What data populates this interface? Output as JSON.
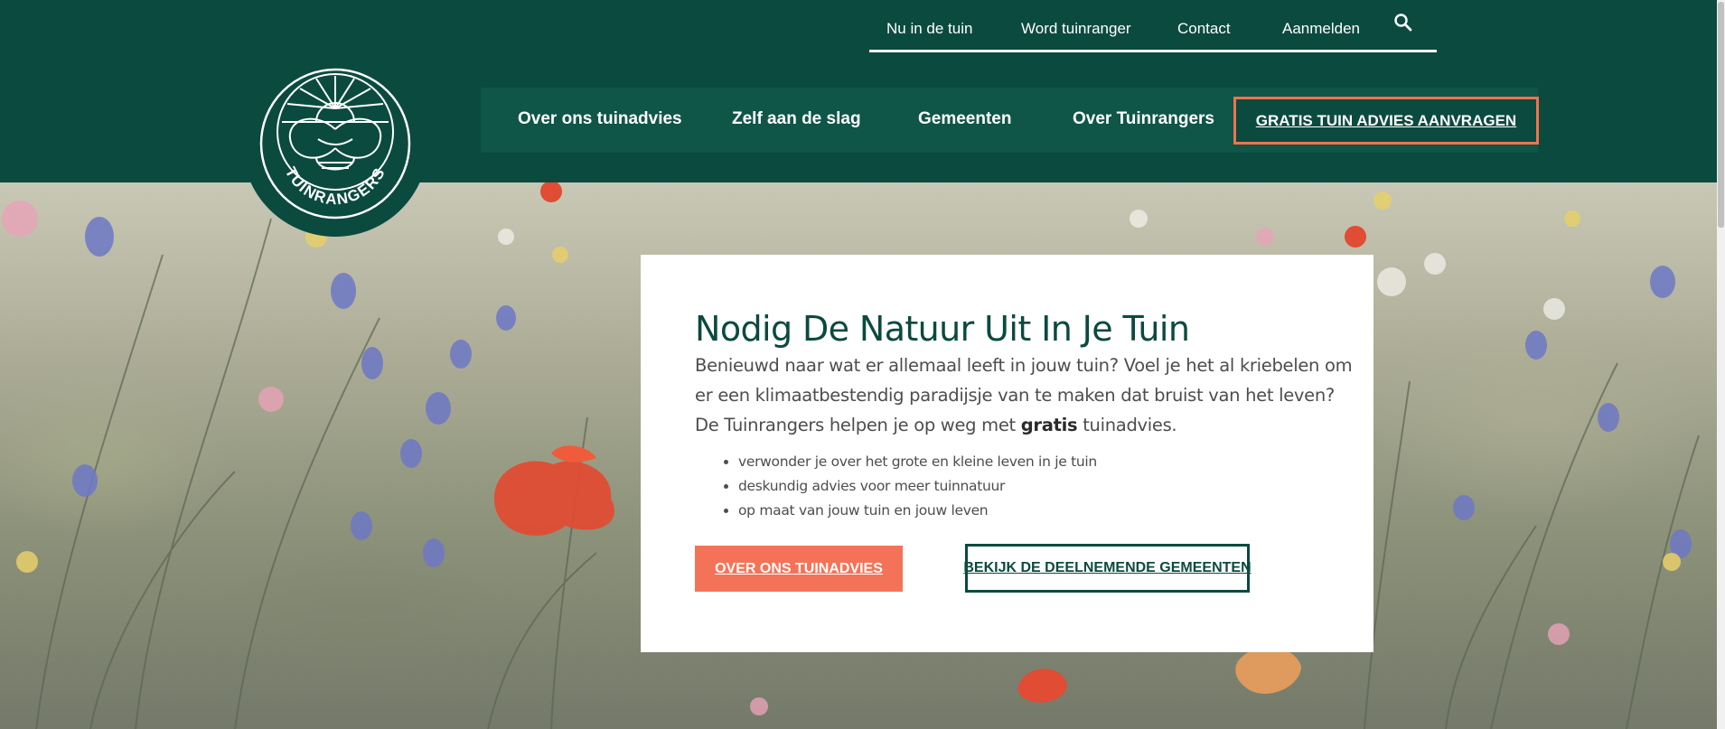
{
  "brand": {
    "name": "TUINRANGERS",
    "primary_color": "#0b4a3f",
    "accent_color": "#f47358"
  },
  "top_nav": {
    "items": [
      "Nu in de tuin",
      "Word tuinranger",
      "Contact",
      "Aanmelden"
    ],
    "search_icon": "search-icon"
  },
  "main_nav": {
    "items": [
      "Over ons tuinadvies",
      "Zelf aan de slag",
      "Gemeenten",
      "Over Tuinrangers"
    ],
    "cta": "GRATIS TUIN ADVIES AANVRAGEN"
  },
  "hero": {
    "title": "Nodig De Natuur Uit In Je Tuin",
    "intro_before": "Benieuwd naar wat er allemaal leeft in jouw tuin? Voel je het al kriebelen om er een klimaatbestendig paradijsje van te maken dat bruist van het leven? De Tuinrangers helpen je op weg met ",
    "intro_bold": "gratis",
    "intro_after": " tuinadvies.",
    "bullets": [
      "verwonder je over het grote en kleine leven in je tuin",
      "deskundig advies voor meer tuinnatuur",
      "op maat van jouw tuin en jouw leven"
    ],
    "primary_button": "OVER ONS TUINADVIES",
    "secondary_button": "BEKIJK DE DEELNEMENDE GEMEENTEN"
  }
}
